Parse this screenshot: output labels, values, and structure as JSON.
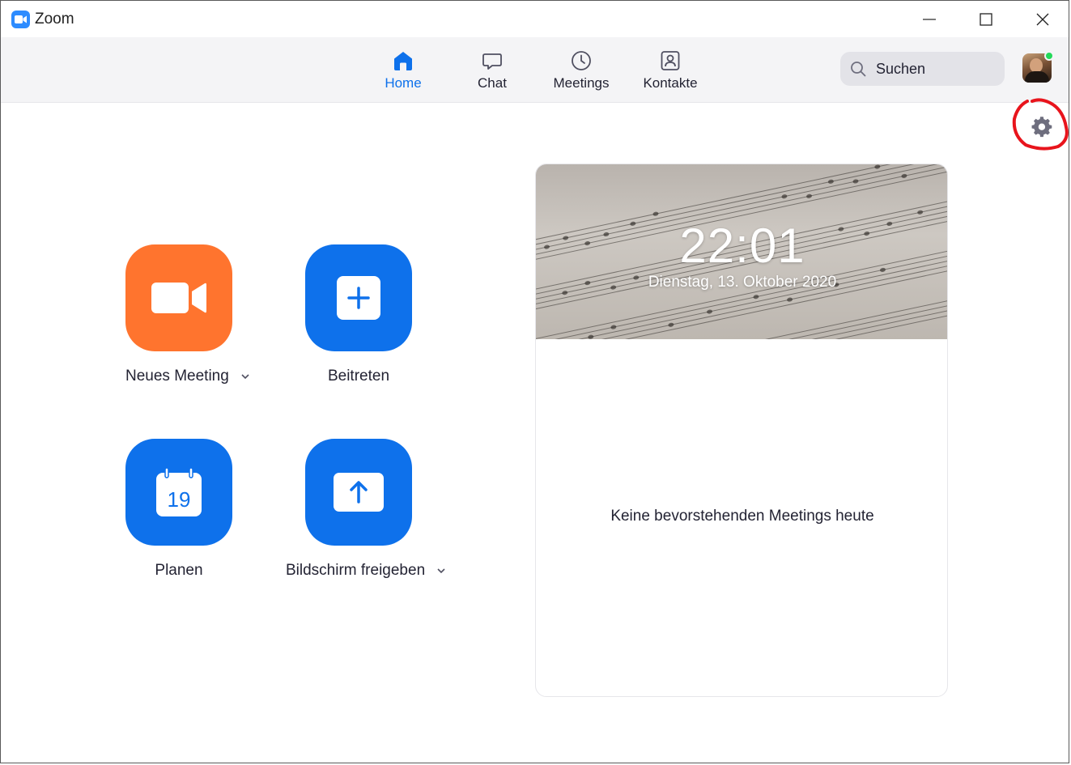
{
  "window": {
    "title": "Zoom",
    "controls": {
      "minimize": "minimize-icon",
      "maximize": "maximize-icon",
      "close": "close-icon"
    }
  },
  "nav": {
    "items": [
      {
        "label": "Home",
        "icon": "home-icon",
        "active": true
      },
      {
        "label": "Chat",
        "icon": "chat-icon",
        "active": false
      },
      {
        "label": "Meetings",
        "icon": "clock-icon",
        "active": false
      },
      {
        "label": "Kontakte",
        "icon": "contacts-icon",
        "active": false
      }
    ],
    "active_color": "#0E71EB"
  },
  "search": {
    "placeholder": "Suchen",
    "value": ""
  },
  "user": {
    "status": "online",
    "status_color": "#23d959"
  },
  "actions": [
    {
      "label": "Neues Meeting",
      "icon": "video-camera-icon",
      "color": "#FF742E",
      "has_dropdown": true
    },
    {
      "label": "Beitreten",
      "icon": "plus-icon",
      "color": "#0E71EB",
      "has_dropdown": false
    },
    {
      "label": "Planen",
      "icon": "calendar-icon",
      "calendar_day": "19",
      "color": "#0E71EB",
      "has_dropdown": false
    },
    {
      "label": "Bildschirm freigeben",
      "icon": "share-up-arrow-icon",
      "color": "#0E71EB",
      "has_dropdown": true
    }
  ],
  "clock": {
    "time": "22:01",
    "date": "Dienstag, 13. Oktober 2020"
  },
  "meetings": {
    "empty_text": "Keine bevorstehenden Meetings heute"
  },
  "annotation": {
    "color": "#e8141c"
  }
}
